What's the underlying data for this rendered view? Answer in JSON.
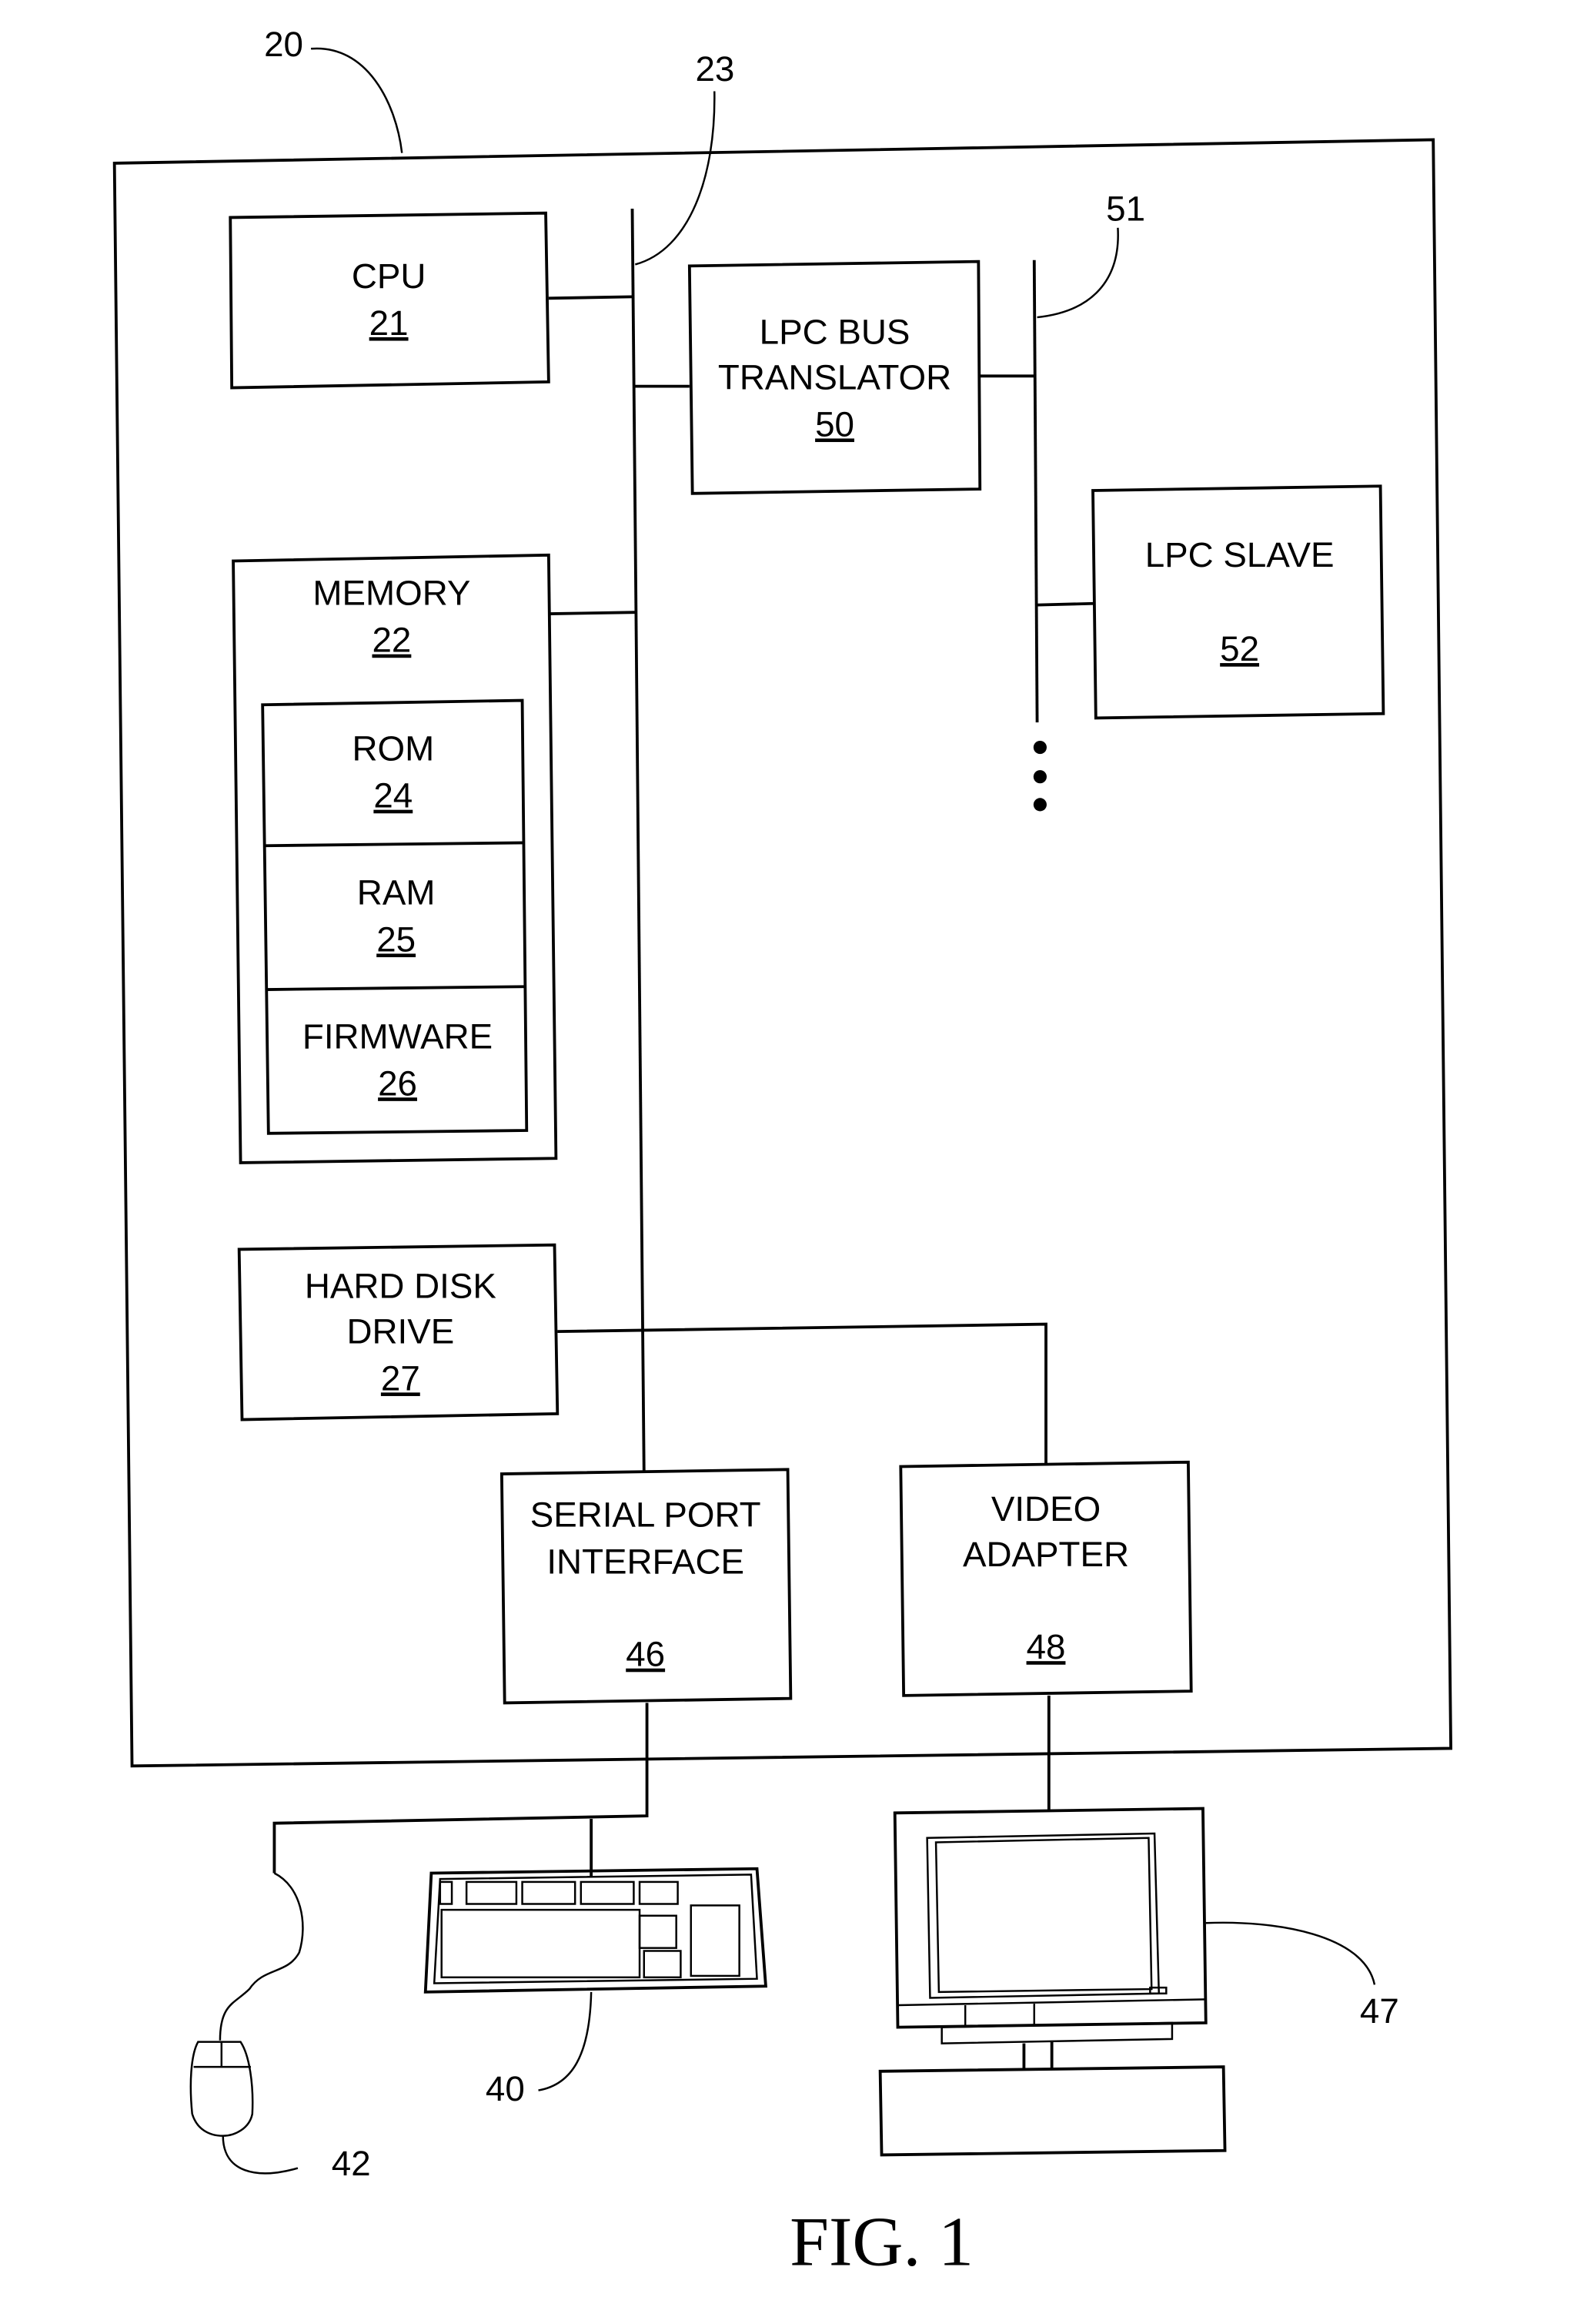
{
  "figure": {
    "caption": "FIG. 1",
    "system_ref": "20",
    "system_bus_ref": "23",
    "lpc_bus_ref": "51"
  },
  "blocks": {
    "cpu": {
      "line1": "CPU",
      "num": "21"
    },
    "memory": {
      "line1": "MEMORY",
      "num": "22"
    },
    "rom": {
      "line1": "ROM",
      "num": "24"
    },
    "ram": {
      "line1": "RAM",
      "num": "25"
    },
    "firmware": {
      "line1": "FIRMWARE",
      "num": "26"
    },
    "hdd": {
      "line1": "HARD DISK",
      "line2": "DRIVE",
      "num": "27"
    },
    "lpc_translator": {
      "line1": "LPC BUS",
      "line2": "TRANSLATOR",
      "num": "50"
    },
    "lpc_slave": {
      "line1": "LPC SLAVE",
      "num": "52"
    },
    "serial_port": {
      "line1": "SERIAL PORT",
      "line2": "INTERFACE",
      "num": "46"
    },
    "video_adapter": {
      "line1": "VIDEO",
      "line2": "ADAPTER",
      "num": "48"
    }
  },
  "peripherals": {
    "keyboard_ref": "40",
    "mouse_ref": "42",
    "monitor_ref": "47"
  }
}
